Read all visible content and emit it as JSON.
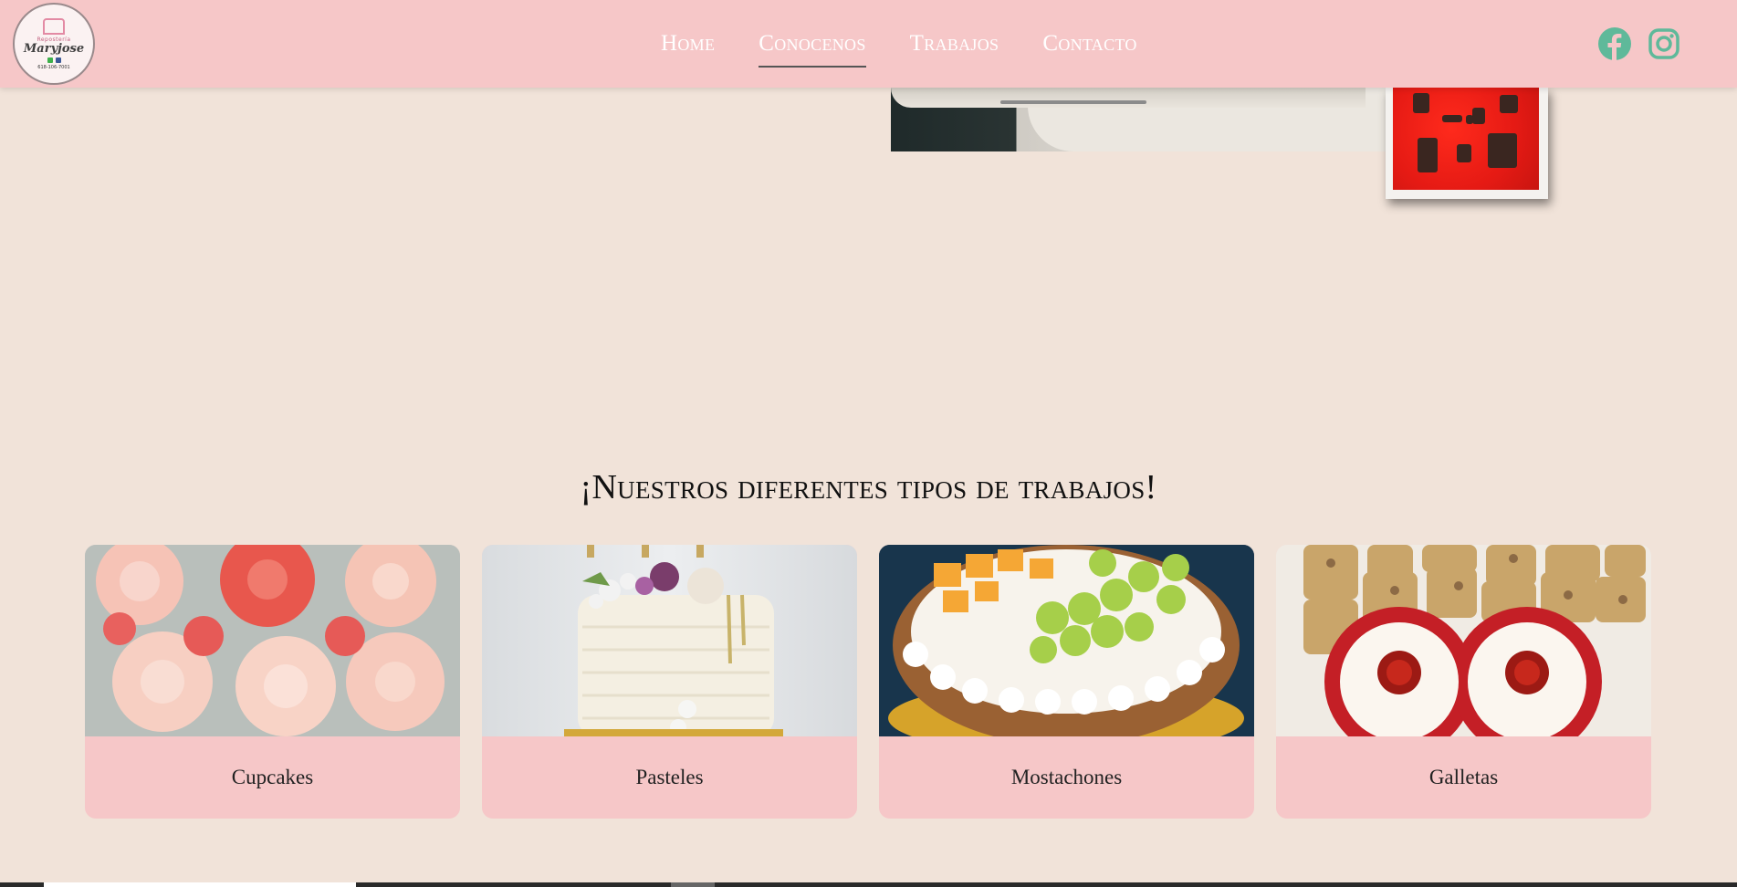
{
  "header": {
    "logo": {
      "small_text": "Repostería",
      "script_text": "Maryjose",
      "phone": "618-106-7001"
    },
    "nav": [
      {
        "label": "Home",
        "active": false
      },
      {
        "label": "Conocenos",
        "active": true
      },
      {
        "label": "Trabajos",
        "active": false
      },
      {
        "label": "Contacto",
        "active": false
      }
    ],
    "social": [
      {
        "icon": "facebook-icon",
        "color": "#5fb99a"
      },
      {
        "icon": "instagram-icon",
        "color": "#5fb99a"
      }
    ]
  },
  "section": {
    "title": "¡Nuestros diferentes tipos de trabajos!"
  },
  "cards": [
    {
      "label": "Cupcakes"
    },
    {
      "label": "Pasteles"
    },
    {
      "label": "Mostachones"
    },
    {
      "label": "Galletas"
    }
  ],
  "colors": {
    "background": "#f1e3d9",
    "header": "#f6c7c8",
    "accent": "#5fb99a"
  }
}
